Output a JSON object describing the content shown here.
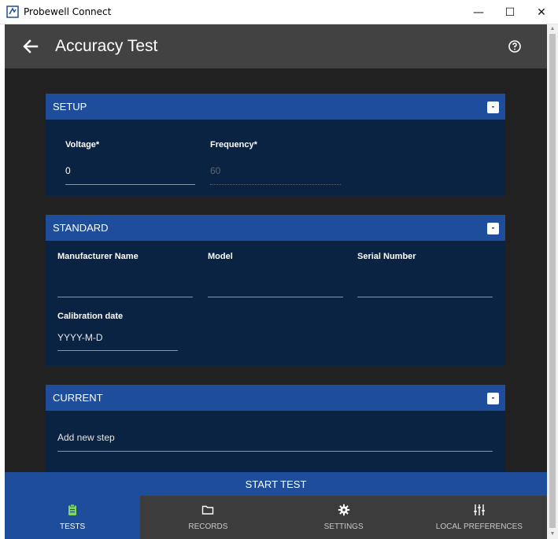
{
  "window": {
    "title": "Probewell Connect",
    "minimize": "—",
    "maximize": "☐",
    "close": "✕"
  },
  "header": {
    "title": "Accuracy Test"
  },
  "setup": {
    "title": "SETUP",
    "collapse": "-",
    "voltage_label": "Voltage*",
    "voltage_value": "0",
    "frequency_label": "Frequency*",
    "frequency_value": "60"
  },
  "standard": {
    "title": "STANDARD",
    "collapse": "-",
    "manufacturer_label": "Manufacturer Name",
    "model_label": "Model",
    "serial_label": "Serial Number",
    "calibration_label": "Calibration date",
    "calibration_placeholder": "YYYY-M-D"
  },
  "current": {
    "title": "CURRENT",
    "collapse": "-",
    "add_step_placeholder": "Add new step"
  },
  "actions": {
    "start_test": "START TEST"
  },
  "nav": {
    "items": [
      {
        "label": "TESTS",
        "icon": "clipboard-icon",
        "active": true
      },
      {
        "label": "RECORDS",
        "icon": "folder-icon",
        "active": false
      },
      {
        "label": "SETTINGS",
        "icon": "gear-icon",
        "active": false
      },
      {
        "label": "LOCAL PREFERENCES",
        "icon": "sliders-icon",
        "active": false
      }
    ]
  },
  "colors": {
    "accent": "#1e4d9c",
    "card_bg": "#0b2342",
    "content_bg": "#212121",
    "header_bg": "#424242",
    "active_icon": "#7ed957"
  }
}
